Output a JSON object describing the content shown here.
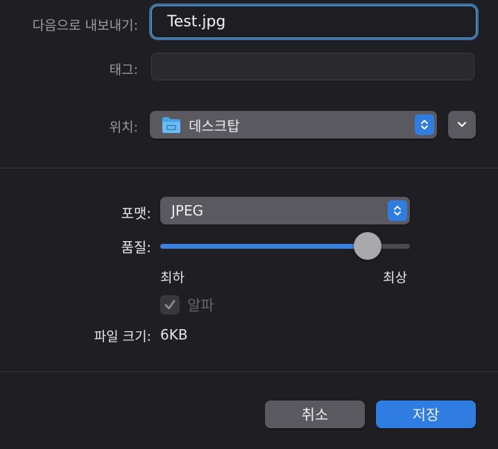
{
  "form": {
    "export_as_label": "다음으로 내보내기:",
    "filename_value": "Test.jpg",
    "tags_label": "태그:",
    "tags_value": "",
    "location_label": "위치:",
    "location_value": "데스크탑",
    "location_icon": "folder-icon"
  },
  "options": {
    "format_label": "포맷:",
    "format_value": "JPEG",
    "quality_label": "품질:",
    "quality_value": 0.83,
    "quality_min_label": "최하",
    "quality_max_label": "최상",
    "alpha_label": "알파",
    "alpha_checked": true,
    "alpha_enabled": false,
    "file_size_label": "파일 크기:",
    "file_size_value": "6KB"
  },
  "buttons": {
    "cancel_label": "취소",
    "save_label": "저장"
  },
  "colors": {
    "accent": "#2f7de0",
    "background": "#1f1e23",
    "control": "#5a5960"
  }
}
